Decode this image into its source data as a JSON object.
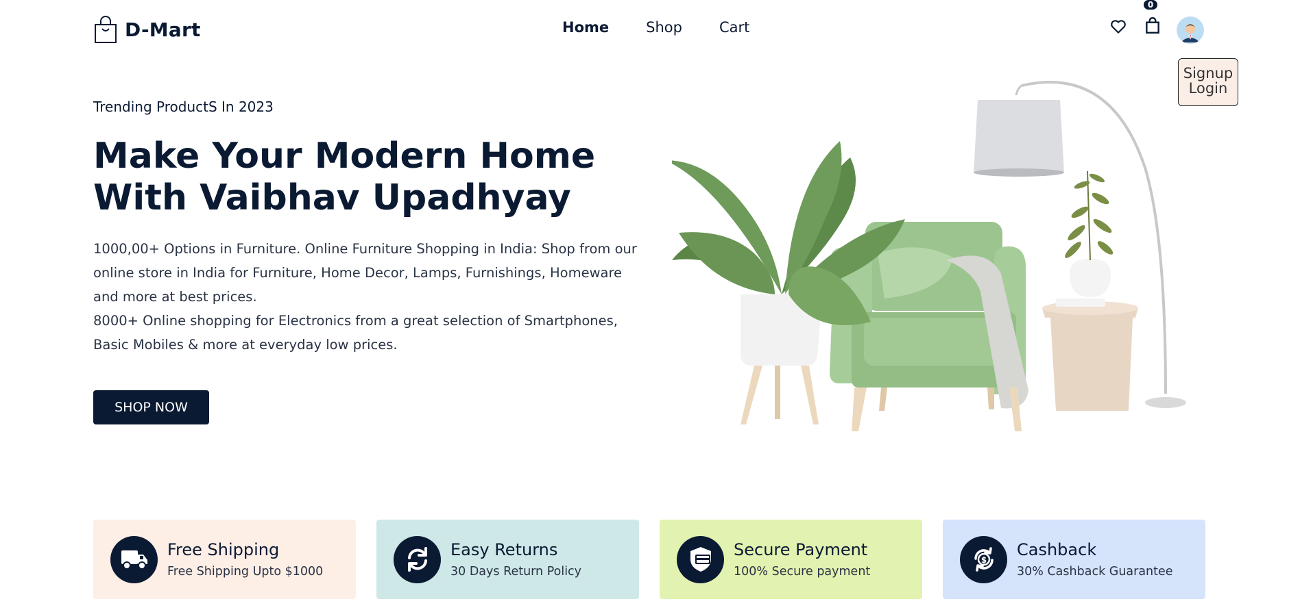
{
  "brand": {
    "name": "D-Mart"
  },
  "nav": {
    "home": "Home",
    "shop": "Shop",
    "cart": "Cart"
  },
  "cart": {
    "count": "0"
  },
  "auth": {
    "signup": "Signup",
    "login": "Login"
  },
  "hero": {
    "subtitle": "Trending ProductS In 2023",
    "title": "Make Your Modern Home With Vaibhav Upadhyay",
    "paragraph1": "1000,00+ Options in Furniture. Online Furniture Shopping in India: Shop from our online store in India for Furniture, Home Decor, Lamps, Furnishings, Homeware and more at best prices.",
    "paragraph2": "8000+ Online shopping for Electronics from a great selection of Smartphones, Basic Mobiles & more at everyday low prices.",
    "cta": "SHOP NOW"
  },
  "features": [
    {
      "title": "Free Shipping",
      "desc": "Free Shipping Upto $1000",
      "icon": "truck-icon",
      "bg": "#fdeee6"
    },
    {
      "title": "Easy Returns",
      "desc": "30 Days Return Policy",
      "icon": "refresh-icon",
      "bg": "#cde8e7"
    },
    {
      "title": "Secure Payment",
      "desc": "100% Secure payment",
      "icon": "shield-card-icon",
      "bg": "#e2f2b0"
    },
    {
      "title": "Cashback",
      "desc": "30% Cashback Guarantee",
      "icon": "cashback-icon",
      "bg": "#d5e3fb"
    }
  ],
  "colors": {
    "primary": "#0b1a33"
  }
}
